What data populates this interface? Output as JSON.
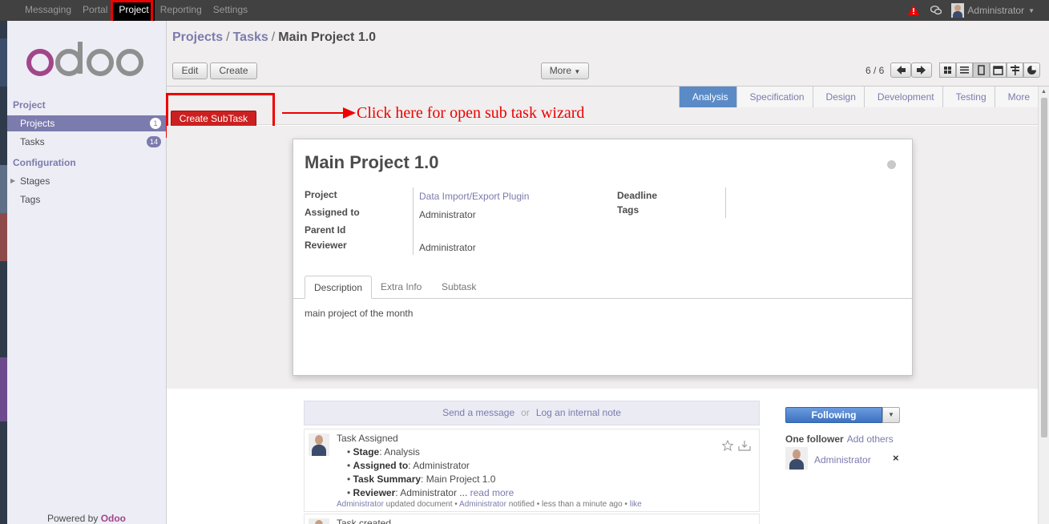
{
  "topbar": {
    "menu": [
      "Messaging",
      "Portal",
      "Project",
      "Reporting",
      "Settings"
    ],
    "active_menu": "Project",
    "user": "Administrator"
  },
  "sidebar": {
    "logo_text": "odoo",
    "sections": [
      {
        "title": "Project",
        "items": [
          {
            "label": "Projects",
            "badge": "1"
          },
          {
            "label": "Tasks",
            "badge": "14"
          }
        ]
      },
      {
        "title": "Configuration",
        "items": [
          {
            "label": "Stages"
          },
          {
            "label": "Tags"
          }
        ]
      }
    ],
    "powered_by": "Powered by",
    "powered_brand": "Odoo"
  },
  "breadcrumb": {
    "projects": "Projects",
    "tasks": "Tasks",
    "sep": "/",
    "current": "Main Project 1.0"
  },
  "toolbar": {
    "edit": "Edit",
    "create": "Create",
    "more": "More",
    "pager": "6 / 6"
  },
  "stages": [
    "Analysis",
    "Specification",
    "Design",
    "Development",
    "Testing",
    "More"
  ],
  "active_stage": "Analysis",
  "create_subtask": "Create SubTask",
  "annotation": "Click here for open sub task wizard",
  "form": {
    "title": "Main Project 1.0",
    "labels": {
      "project": "Project",
      "assigned": "Assigned to",
      "parent": "Parent Id",
      "reviewer": "Reviewer",
      "deadline": "Deadline",
      "tags": "Tags"
    },
    "values": {
      "project": "Data Import/Export Plugin",
      "assigned": "Administrator",
      "reviewer": "Administrator"
    },
    "tabs": [
      "Description",
      "Extra Info",
      "Subtask"
    ],
    "description": "main project of the month"
  },
  "chatter": {
    "send": "Send a message",
    "or": "or",
    "log": "Log an internal note",
    "messages": [
      {
        "title": "Task Assigned",
        "lines": [
          {
            "key": "Stage",
            "value": ": Analysis"
          },
          {
            "key": "Assigned to",
            "value": ": Administrator"
          },
          {
            "key": "Task Summary",
            "value": ": Main Project 1.0"
          },
          {
            "key": "Reviewer",
            "value": ": Administrator ..."
          }
        ],
        "read_more": "read more",
        "foot": {
          "author": "Administrator",
          "t1": " updated document • ",
          "notified": "Administrator",
          "t2": " notified • less than a minute ago • ",
          "like": "like"
        }
      },
      {
        "title": "Task created"
      }
    ],
    "following": "Following",
    "followers": "One follower",
    "add_others": "Add others",
    "follower_name": "Administrator"
  }
}
